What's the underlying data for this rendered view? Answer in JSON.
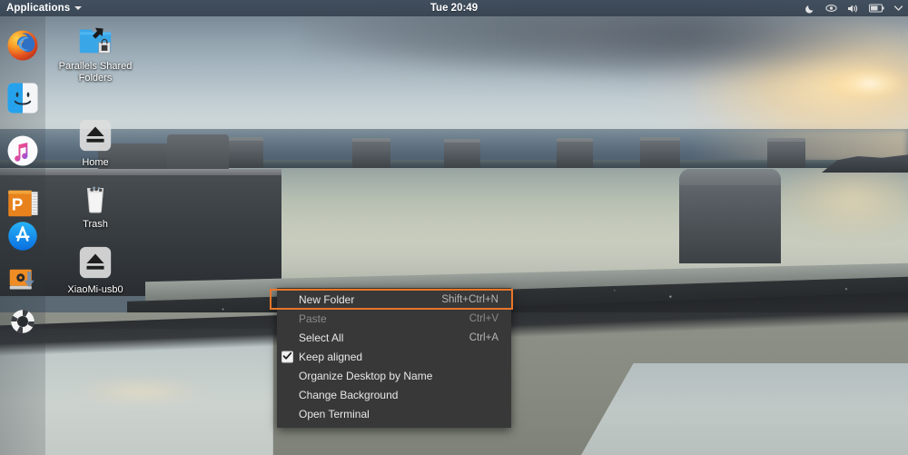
{
  "desktop": {
    "environment": "Ubuntu MATE desktop",
    "wallpaper_description": "Coastal tidal pool at dusk with concrete pillars and seawall"
  },
  "topbar": {
    "applications_label": "Applications",
    "applications_caret": "chevron-down-icon",
    "clock": "Tue 20:49",
    "tray": [
      {
        "name": "night-mode-icon",
        "glyph": "crescent-moon"
      },
      {
        "name": "display-icon",
        "glyph": "eye"
      },
      {
        "name": "volume-icon",
        "glyph": "speaker"
      },
      {
        "name": "battery-icon",
        "glyph": "battery"
      },
      {
        "name": "session-menu-icon",
        "glyph": "chevron-down"
      }
    ]
  },
  "dock": {
    "items": [
      {
        "name": "dock-item-firefox",
        "label": "Firefox"
      },
      {
        "name": "dock-item-finder",
        "label": "Finder"
      },
      {
        "name": "dock-item-music",
        "label": "Music"
      },
      {
        "name": "dock-item-powerpoint",
        "label": "PowerPoint"
      },
      {
        "name": "dock-item-app-store",
        "label": "App Store"
      },
      {
        "name": "dock-item-software-update",
        "label": "Software Update"
      },
      {
        "name": "dock-item-lifesaver",
        "label": "Help"
      }
    ]
  },
  "desktop_icons": [
    {
      "name": "desktop-icon-parallels-shared-folders",
      "label": "Parallels Shared Folders",
      "icon": "folder-shortcut-locked-icon"
    },
    {
      "name": "desktop-icon-home",
      "label": "Home",
      "icon": "eject-icon"
    },
    {
      "name": "desktop-icon-trash",
      "label": "Trash",
      "icon": "trash-icon"
    },
    {
      "name": "desktop-icon-xiaomi-usb0",
      "label": "XiaoMi-usb0",
      "icon": "eject-icon"
    }
  ],
  "context_menu": {
    "items": [
      {
        "name": "menu-item-new-folder",
        "label": "New Folder",
        "accel": "Shift+Ctrl+N",
        "disabled": false,
        "checked": null,
        "highlighted": true
      },
      {
        "name": "menu-item-paste",
        "label": "Paste",
        "accel": "Ctrl+V",
        "disabled": true,
        "checked": null,
        "highlighted": false
      },
      {
        "name": "menu-item-select-all",
        "label": "Select All",
        "accel": "Ctrl+A",
        "disabled": false,
        "checked": null,
        "highlighted": false
      },
      {
        "name": "menu-item-keep-aligned",
        "label": "Keep aligned",
        "accel": "",
        "disabled": false,
        "checked": true,
        "highlighted": false
      },
      {
        "name": "menu-item-organize-desktop-by-name",
        "label": "Organize Desktop by Name",
        "accel": "",
        "disabled": false,
        "checked": null,
        "highlighted": false
      },
      {
        "name": "menu-item-change-background",
        "label": "Change Background",
        "accel": "",
        "disabled": false,
        "checked": null,
        "highlighted": false
      },
      {
        "name": "menu-item-open-terminal",
        "label": "Open Terminal",
        "accel": "",
        "disabled": false,
        "checked": null,
        "highlighted": false
      }
    ]
  },
  "colors": {
    "menu_background": "#383838",
    "menu_text": "#e8e8e8",
    "menu_disabled_text": "#8a8a8a",
    "highlight_border": "#e8762a",
    "topbar_background": "#3a4858",
    "topbar_text": "#ffffff"
  }
}
